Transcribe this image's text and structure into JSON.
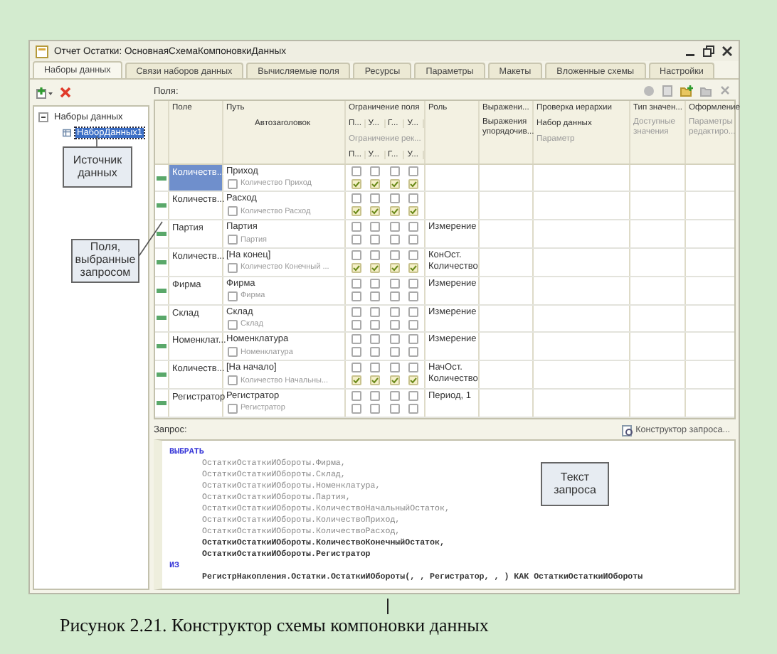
{
  "window": {
    "title": "Отчет Остатки: ОсновнаяСхемаКомпоновкиДанных"
  },
  "tabs": [
    {
      "label": "Наборы данных",
      "selected": true
    },
    {
      "label": "Связи наборов данных",
      "selected": false
    },
    {
      "label": "Вычисляемые поля",
      "selected": false
    },
    {
      "label": "Ресурсы",
      "selected": false
    },
    {
      "label": "Параметры",
      "selected": false
    },
    {
      "label": "Макеты",
      "selected": false
    },
    {
      "label": "Вложенные схемы",
      "selected": false
    },
    {
      "label": "Настройки",
      "selected": false
    }
  ],
  "tree": {
    "label": "Наборы данных",
    "expanded": true,
    "children": [
      {
        "label": "НаборДанных1",
        "selected": true
      }
    ]
  },
  "fields": {
    "label": "Поля:",
    "header": {
      "field": "Поле",
      "path": "Путь",
      "autotitle": "Автозаголовок",
      "restriction": "Ограничение поля",
      "restriction_flags": [
        "П...",
        "У...",
        "Г...",
        "У..."
      ],
      "restriction_req": "Ограничение рек...",
      "restriction_req_flags": [
        "П...",
        "У...",
        "Г...",
        "У..."
      ],
      "role": "Роль",
      "expression": "Выражени...",
      "order_expression": "Выражения упорядочив...",
      "hierarchy": "Проверка иерархии",
      "dataset": "Набор данных",
      "parameter": "Параметр",
      "value_type": "Тип значен...",
      "available": "Доступные значения",
      "design": "Оформление",
      "edit_params": "Параметры редактиро..."
    },
    "rows": [
      {
        "field": "Количеств...",
        "path": "Приход",
        "title": "Количество Приход",
        "title_checked": false,
        "restriction": [
          false,
          false,
          false,
          false
        ],
        "restriction_req": [
          true,
          true,
          true,
          true
        ],
        "selected": true
      },
      {
        "field": "Количеств...",
        "path": "Расход",
        "title": "Количество Расход",
        "title_checked": false,
        "restriction": [
          false,
          false,
          false,
          false
        ],
        "restriction_req": [
          true,
          true,
          true,
          true
        ],
        "selected": false
      },
      {
        "field": "Партия",
        "path": "Партия",
        "title": "Партия",
        "title_checked": false,
        "restriction": [
          false,
          false,
          false,
          false
        ],
        "restriction_req": [
          false,
          false,
          false,
          false
        ],
        "role": "Измерение",
        "selected": false
      },
      {
        "field": "Количеств...",
        "path": "[На конец]",
        "title": "Количество Конечный ...",
        "title_checked": false,
        "restriction": [
          false,
          false,
          false,
          false
        ],
        "restriction_req": [
          true,
          true,
          true,
          true
        ],
        "role": "КонОст. Количество",
        "selected": false
      },
      {
        "field": "Фирма",
        "path": "Фирма",
        "title": "Фирма",
        "title_checked": false,
        "restriction": [
          false,
          false,
          false,
          false
        ],
        "restriction_req": [
          false,
          false,
          false,
          false
        ],
        "role": "Измерение",
        "selected": false
      },
      {
        "field": "Склад",
        "path": "Склад",
        "title": "Склад",
        "title_checked": false,
        "restriction": [
          false,
          false,
          false,
          false
        ],
        "restriction_req": [
          false,
          false,
          false,
          false
        ],
        "role": "Измерение",
        "selected": false
      },
      {
        "field": "Номенклат...",
        "path": "Номенклатура",
        "title": "Номенклатура",
        "title_checked": false,
        "restriction": [
          false,
          false,
          false,
          false
        ],
        "restriction_req": [
          false,
          false,
          false,
          false
        ],
        "role": "Измерение",
        "selected": false
      },
      {
        "field": "Количеств...",
        "path": "[На начало]",
        "title": "Количество Начальны...",
        "title_checked": false,
        "restriction": [
          false,
          false,
          false,
          false
        ],
        "restriction_req": [
          true,
          true,
          true,
          true
        ],
        "role": "НачОст. Количество",
        "selected": false
      },
      {
        "field": "Регистратор",
        "path": "Регистратор",
        "title": "Регистратор",
        "title_checked": false,
        "restriction": [
          false,
          false,
          false,
          false
        ],
        "restriction_req": [
          false,
          false,
          false,
          false
        ],
        "role": "Период, 1",
        "selected": false
      }
    ]
  },
  "query": {
    "label": "Запрос:",
    "designer": "Конструктор запроса...",
    "lines": [
      {
        "kind": "keyword",
        "text": "ВЫБРАТЬ"
      },
      {
        "kind": "dim",
        "text": "ОстаткиОстаткиИОбороты.Фирма,"
      },
      {
        "kind": "dim",
        "text": "ОстаткиОстаткиИОбороты.Склад,"
      },
      {
        "kind": "dim",
        "text": "ОстаткиОстаткиИОбороты.Номенклатура,"
      },
      {
        "kind": "dim",
        "text": "ОстаткиОстаткиИОбороты.Партия,"
      },
      {
        "kind": "dim",
        "text": "ОстаткиОстаткиИОбороты.КоличествоНачальныйОстаток,"
      },
      {
        "kind": "dim",
        "text": "ОстаткиОстаткиИОбороты.КоличествоПриход,"
      },
      {
        "kind": "dim",
        "text": "ОстаткиОстаткиИОбороты.КоличествоРасход,"
      },
      {
        "kind": "bold",
        "text": "ОстаткиОстаткиИОбороты.КоличествоКонечныйОстаток,"
      },
      {
        "kind": "bold",
        "text": "ОстаткиОстаткиИОбороты.Регистратор"
      },
      {
        "kind": "keyword",
        "text": "ИЗ"
      },
      {
        "kind": "bold",
        "text": "РегистрНакопления.Остатки.ОстаткиИОбороты(, , Регистратор, , ) КАК ОстаткиОстаткиИОбороты"
      }
    ]
  },
  "callouts": [
    {
      "text": "Источник данных"
    },
    {
      "text": "Поля, выбранные запросом"
    },
    {
      "text": "Текст запроса"
    }
  ],
  "caption": "Рисунок 2.21. Конструктор схемы компоновки данных"
}
